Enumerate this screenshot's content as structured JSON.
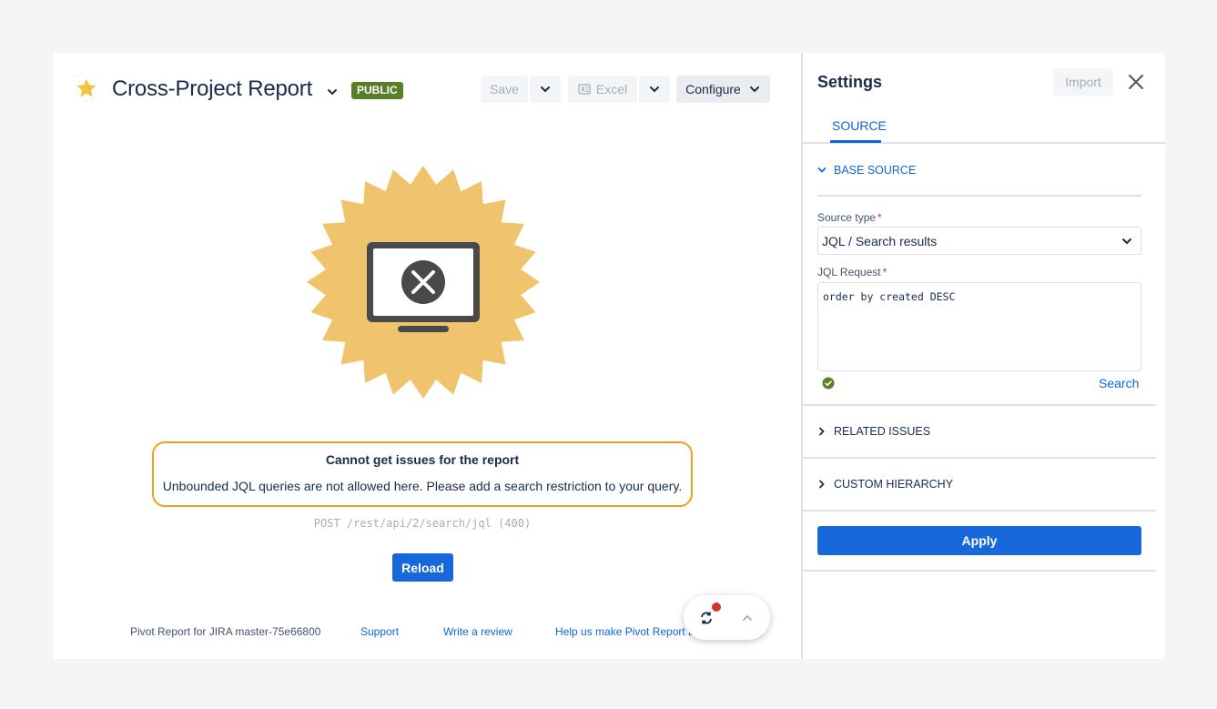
{
  "header": {
    "title": "Cross-Project Report",
    "badge": "PUBLIC",
    "save_label": "Save",
    "excel_label": "Excel",
    "configure_label": "Configure"
  },
  "error": {
    "title": "Cannot get issues for the report",
    "message": "Unbounded JQL queries are not allowed here. Please add a search restriction to your query.",
    "request": "POST /rest/api/2/search/jql (400)",
    "reload_label": "Reload"
  },
  "footer": {
    "version": "Pivot Report for JIRA master-75e66800",
    "support": "Support",
    "review": "Write a review",
    "help": "Help us make Pivot Report b"
  },
  "settings": {
    "title": "Settings",
    "import_label": "Import",
    "tab_source": "SOURCE",
    "base_source": "BASE SOURCE",
    "source_type_label": "Source type",
    "source_type_value": "JQL / Search results",
    "jql_label": "JQL Request",
    "jql_value": "order by created DESC",
    "search_label": "Search",
    "related_issues": "RELATED ISSUES",
    "custom_hierarchy": "CUSTOM HIERARCHY",
    "apply_label": "Apply",
    "required_mark": "*"
  },
  "colors": {
    "accent": "#1868db",
    "badge": "#5a7d2a",
    "star": "#f5c33b",
    "illustration": "#f0c36d",
    "error_border": "#f0a020"
  }
}
